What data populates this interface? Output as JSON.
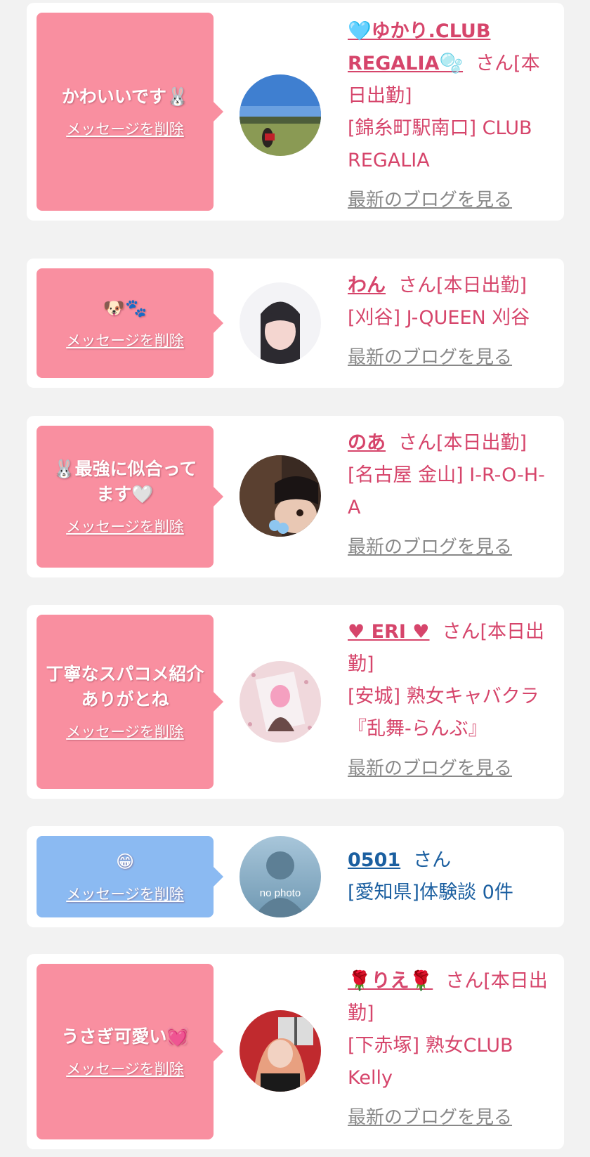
{
  "colors": {
    "page_bg": "#f2f2f2",
    "bubble_pink": "#f98fa0",
    "bubble_blue": "#8bbaf2",
    "name_pink": "#d6456b",
    "name_blue": "#1b5fa0",
    "blog_gray": "#888888"
  },
  "items": [
    {
      "message": "かわいいです🐰",
      "delete_label": "メッセージを削除",
      "name": "🩵ゆかり.CLUB REGALIA🫧",
      "honorific": "さん[本日出勤]",
      "shop": "[錦糸町駅南口] CLUB REGALIA",
      "blog_link": "最新のブログを見る",
      "avatar_icon": "park-photo-avatar"
    },
    {
      "message": "🐶🐾",
      "delete_label": "メッセージを削除",
      "name": "わん",
      "honorific": "さん[本日出勤]",
      "shop": "[刈谷] J-QUEEN 刈谷",
      "blog_link": "最新のブログを見る",
      "avatar_icon": "blurred-girl-avatar"
    },
    {
      "message": "🐰最強に似合ってます🤍",
      "delete_label": "メッセージを削除",
      "name": "のあ",
      "honorific": "さん[本日出勤]",
      "shop": "[名古屋 金山] I-R-O-H-A",
      "blog_link": "最新のブログを見る",
      "avatar_icon": "tiara-girl-avatar"
    },
    {
      "message": "丁寧なスパコメ紹介ありがとね",
      "delete_label": "メッセージを削除",
      "name": "♥ ERI ♥",
      "honorific": "さん[本日出勤]",
      "shop": "[安城] 熟女キャバクラ『乱舞-らんぶ』",
      "blog_link": "最新のブログを見る",
      "avatar_icon": "glitter-girl-avatar"
    },
    {
      "message": "😁",
      "delete_label": "メッセージを削除",
      "name": "0501",
      "honorific": "さん",
      "shop": "[愛知県]体験談 0件",
      "avatar_icon": "no-photo-avatar",
      "avatar_text": "no photo"
    },
    {
      "message": "うさぎ可愛い💓",
      "delete_label": "メッセージを削除",
      "name": "🌹りえ🌹",
      "honorific": "さん[本日出勤]",
      "shop": "[下赤塚] 熟女CLUB Kelly",
      "blog_link": "最新のブログを見る",
      "avatar_icon": "red-room-girl-avatar"
    }
  ]
}
